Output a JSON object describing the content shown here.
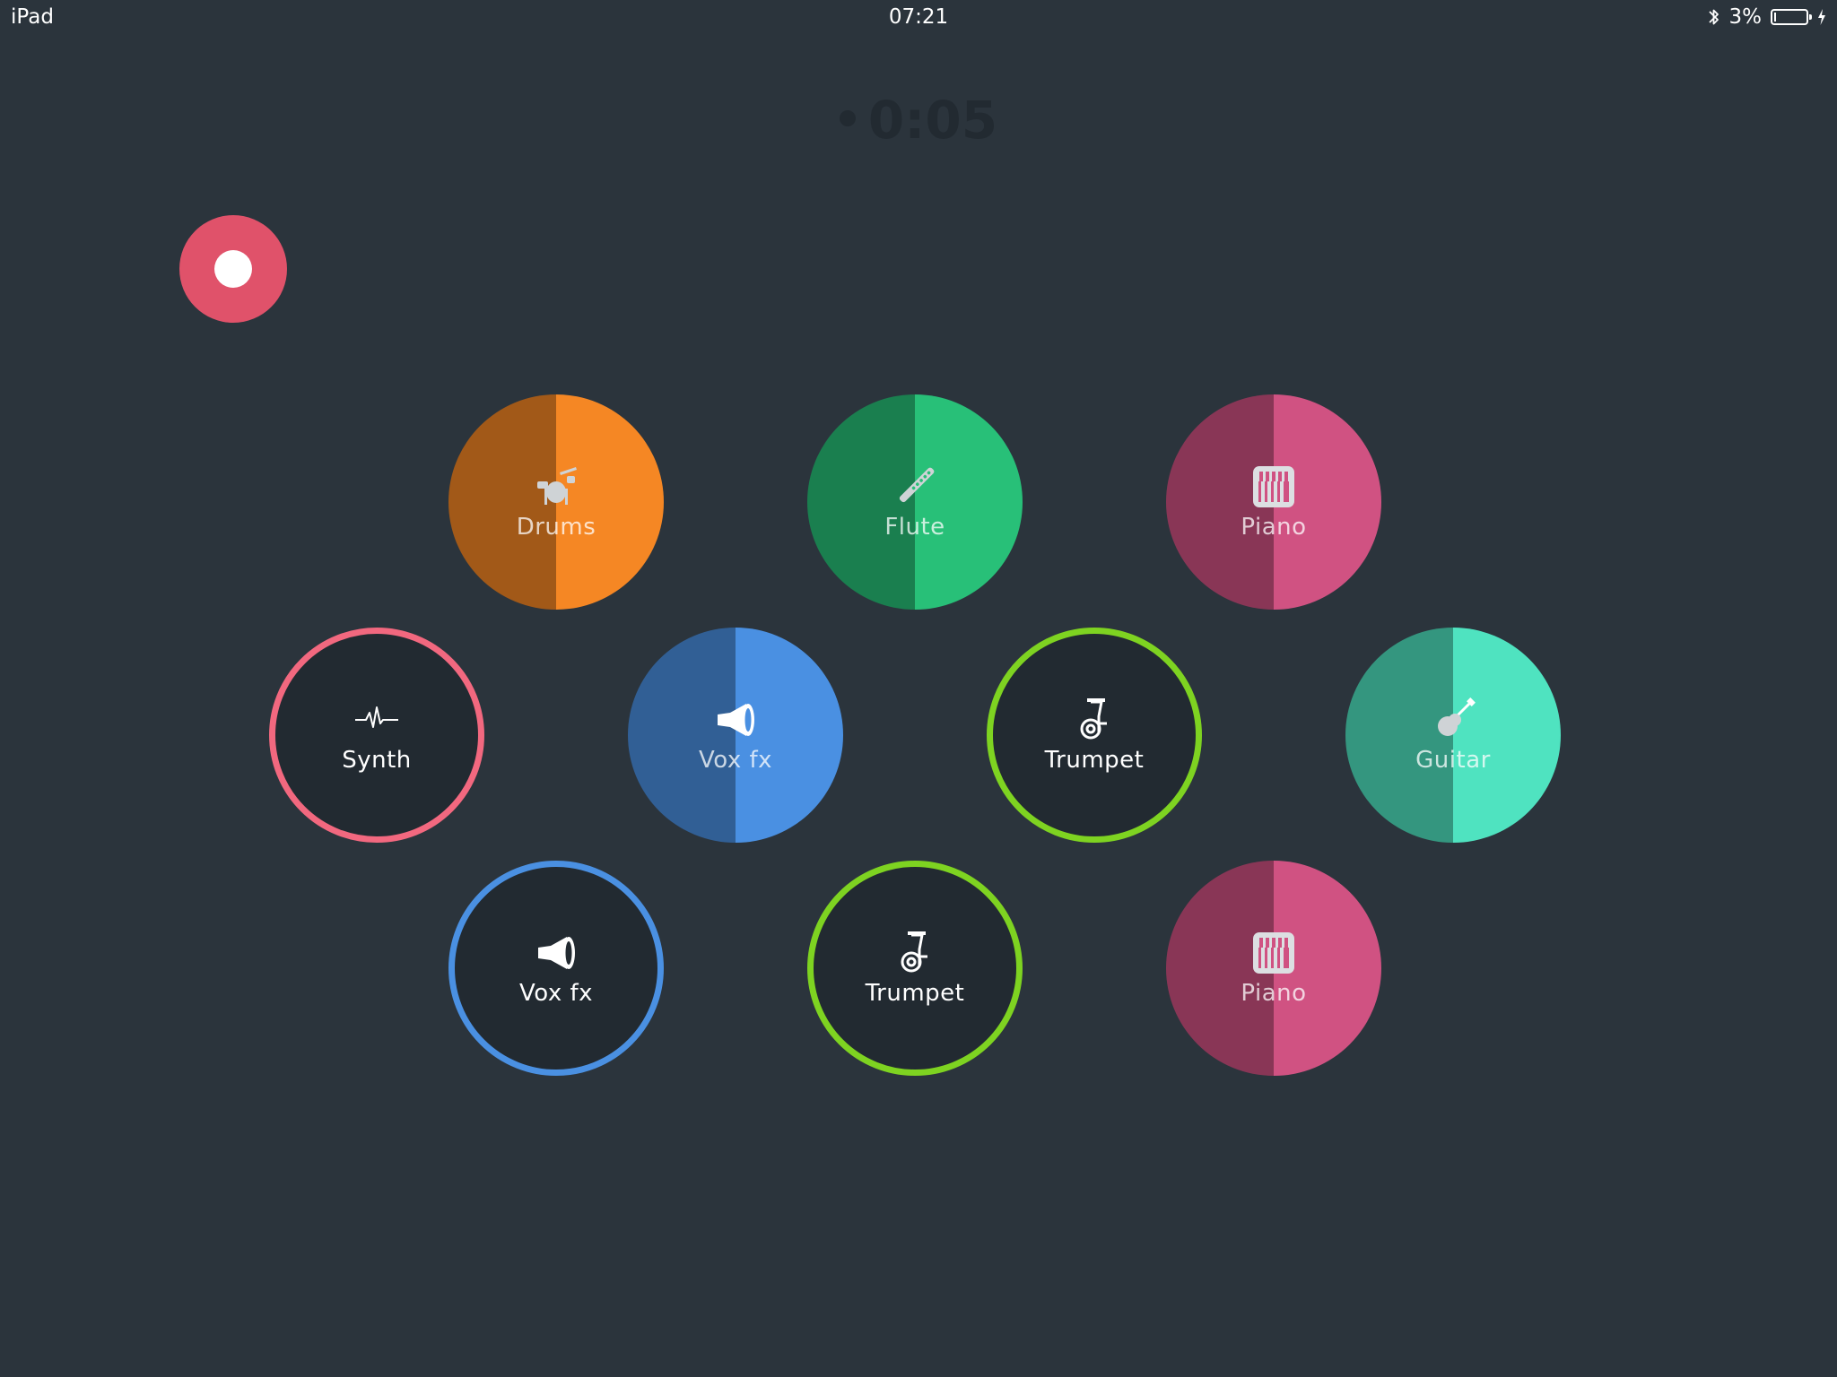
{
  "status_bar": {
    "device": "iPad",
    "time": "07:21",
    "battery_percent": "3%",
    "battery_level": 0.03
  },
  "timer": {
    "value": "0:05"
  },
  "colors": {
    "background": "#2b343c",
    "pad_dark": "#222a31",
    "record": "#e0526a",
    "drums": "#f58724",
    "flute": "#28c078",
    "piano": "#d05282",
    "synth": "#f2687f",
    "vox_fx": "#4a90e2",
    "trumpet": "#7ed321",
    "guitar": "#4fe3c0"
  },
  "pads": [
    {
      "label": "Drums",
      "icon": "drum-kit-icon",
      "style": "filled",
      "color": "#f58724"
    },
    {
      "label": "Flute",
      "icon": "flute-icon",
      "style": "filled",
      "color": "#28c078"
    },
    {
      "label": "Piano",
      "icon": "piano-keys-icon",
      "style": "filled",
      "color": "#d05282"
    },
    {
      "label": "Synth",
      "icon": "waveform-icon",
      "style": "outline",
      "color": "#f2687f"
    },
    {
      "label": "Vox fx",
      "icon": "megaphone-icon",
      "style": "filled",
      "color": "#4a90e2"
    },
    {
      "label": "Trumpet",
      "icon": "tuba-icon",
      "style": "outline",
      "color": "#7ed321"
    },
    {
      "label": "Guitar",
      "icon": "guitar-icon",
      "style": "filled",
      "color": "#4fe3c0"
    },
    {
      "label": "Vox fx",
      "icon": "megaphone-icon",
      "style": "outline",
      "color": "#4a90e2"
    },
    {
      "label": "Trumpet",
      "icon": "tuba-icon",
      "style": "outline",
      "color": "#7ed321"
    },
    {
      "label": "Piano",
      "icon": "piano-keys-icon",
      "style": "filled",
      "color": "#d05282"
    }
  ]
}
